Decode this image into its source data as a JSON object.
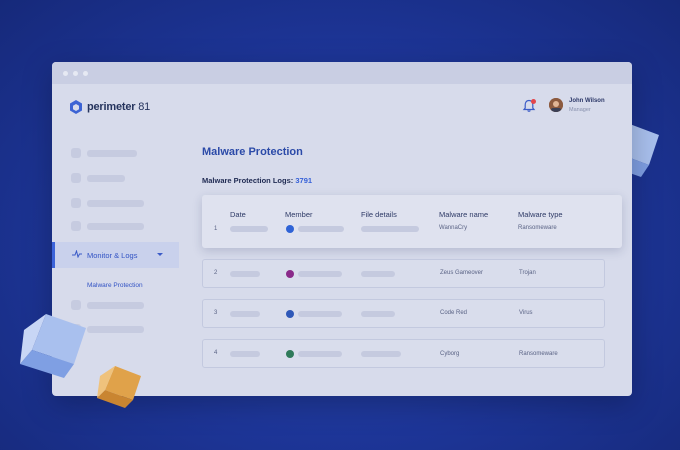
{
  "brand": {
    "name_bold": "perimeter",
    "name_light": "81"
  },
  "user": {
    "name": "John Wilson",
    "role": "Manager"
  },
  "sidebar": {
    "active": {
      "label": "Monitor & Logs"
    },
    "sub_item": "Malware Protection"
  },
  "main": {
    "title": "Malware Protection",
    "logs_label": "Malware Protection Logs:",
    "logs_count": "3791",
    "columns": [
      "Date",
      "Member",
      "File details",
      "Malware name",
      "Malware type"
    ],
    "rows": [
      {
        "num": "1",
        "member_color": "#2f63d6",
        "malware_name": "WannaCry",
        "malware_type": "Ransomeware"
      },
      {
        "num": "2",
        "member_color": "#8a2a8a",
        "malware_name": "Zeus Gameover",
        "malware_type": "Trojan"
      },
      {
        "num": "3",
        "member_color": "#2f58b8",
        "malware_name": "Code Red",
        "malware_type": "Virus"
      },
      {
        "num": "4",
        "member_color": "#2f7a5a",
        "malware_name": "Cyborg",
        "malware_type": "Ransomeware"
      }
    ]
  },
  "colors": {
    "accent": "#3b63d9",
    "background": "#1d3597",
    "alert": "#e3454b"
  }
}
